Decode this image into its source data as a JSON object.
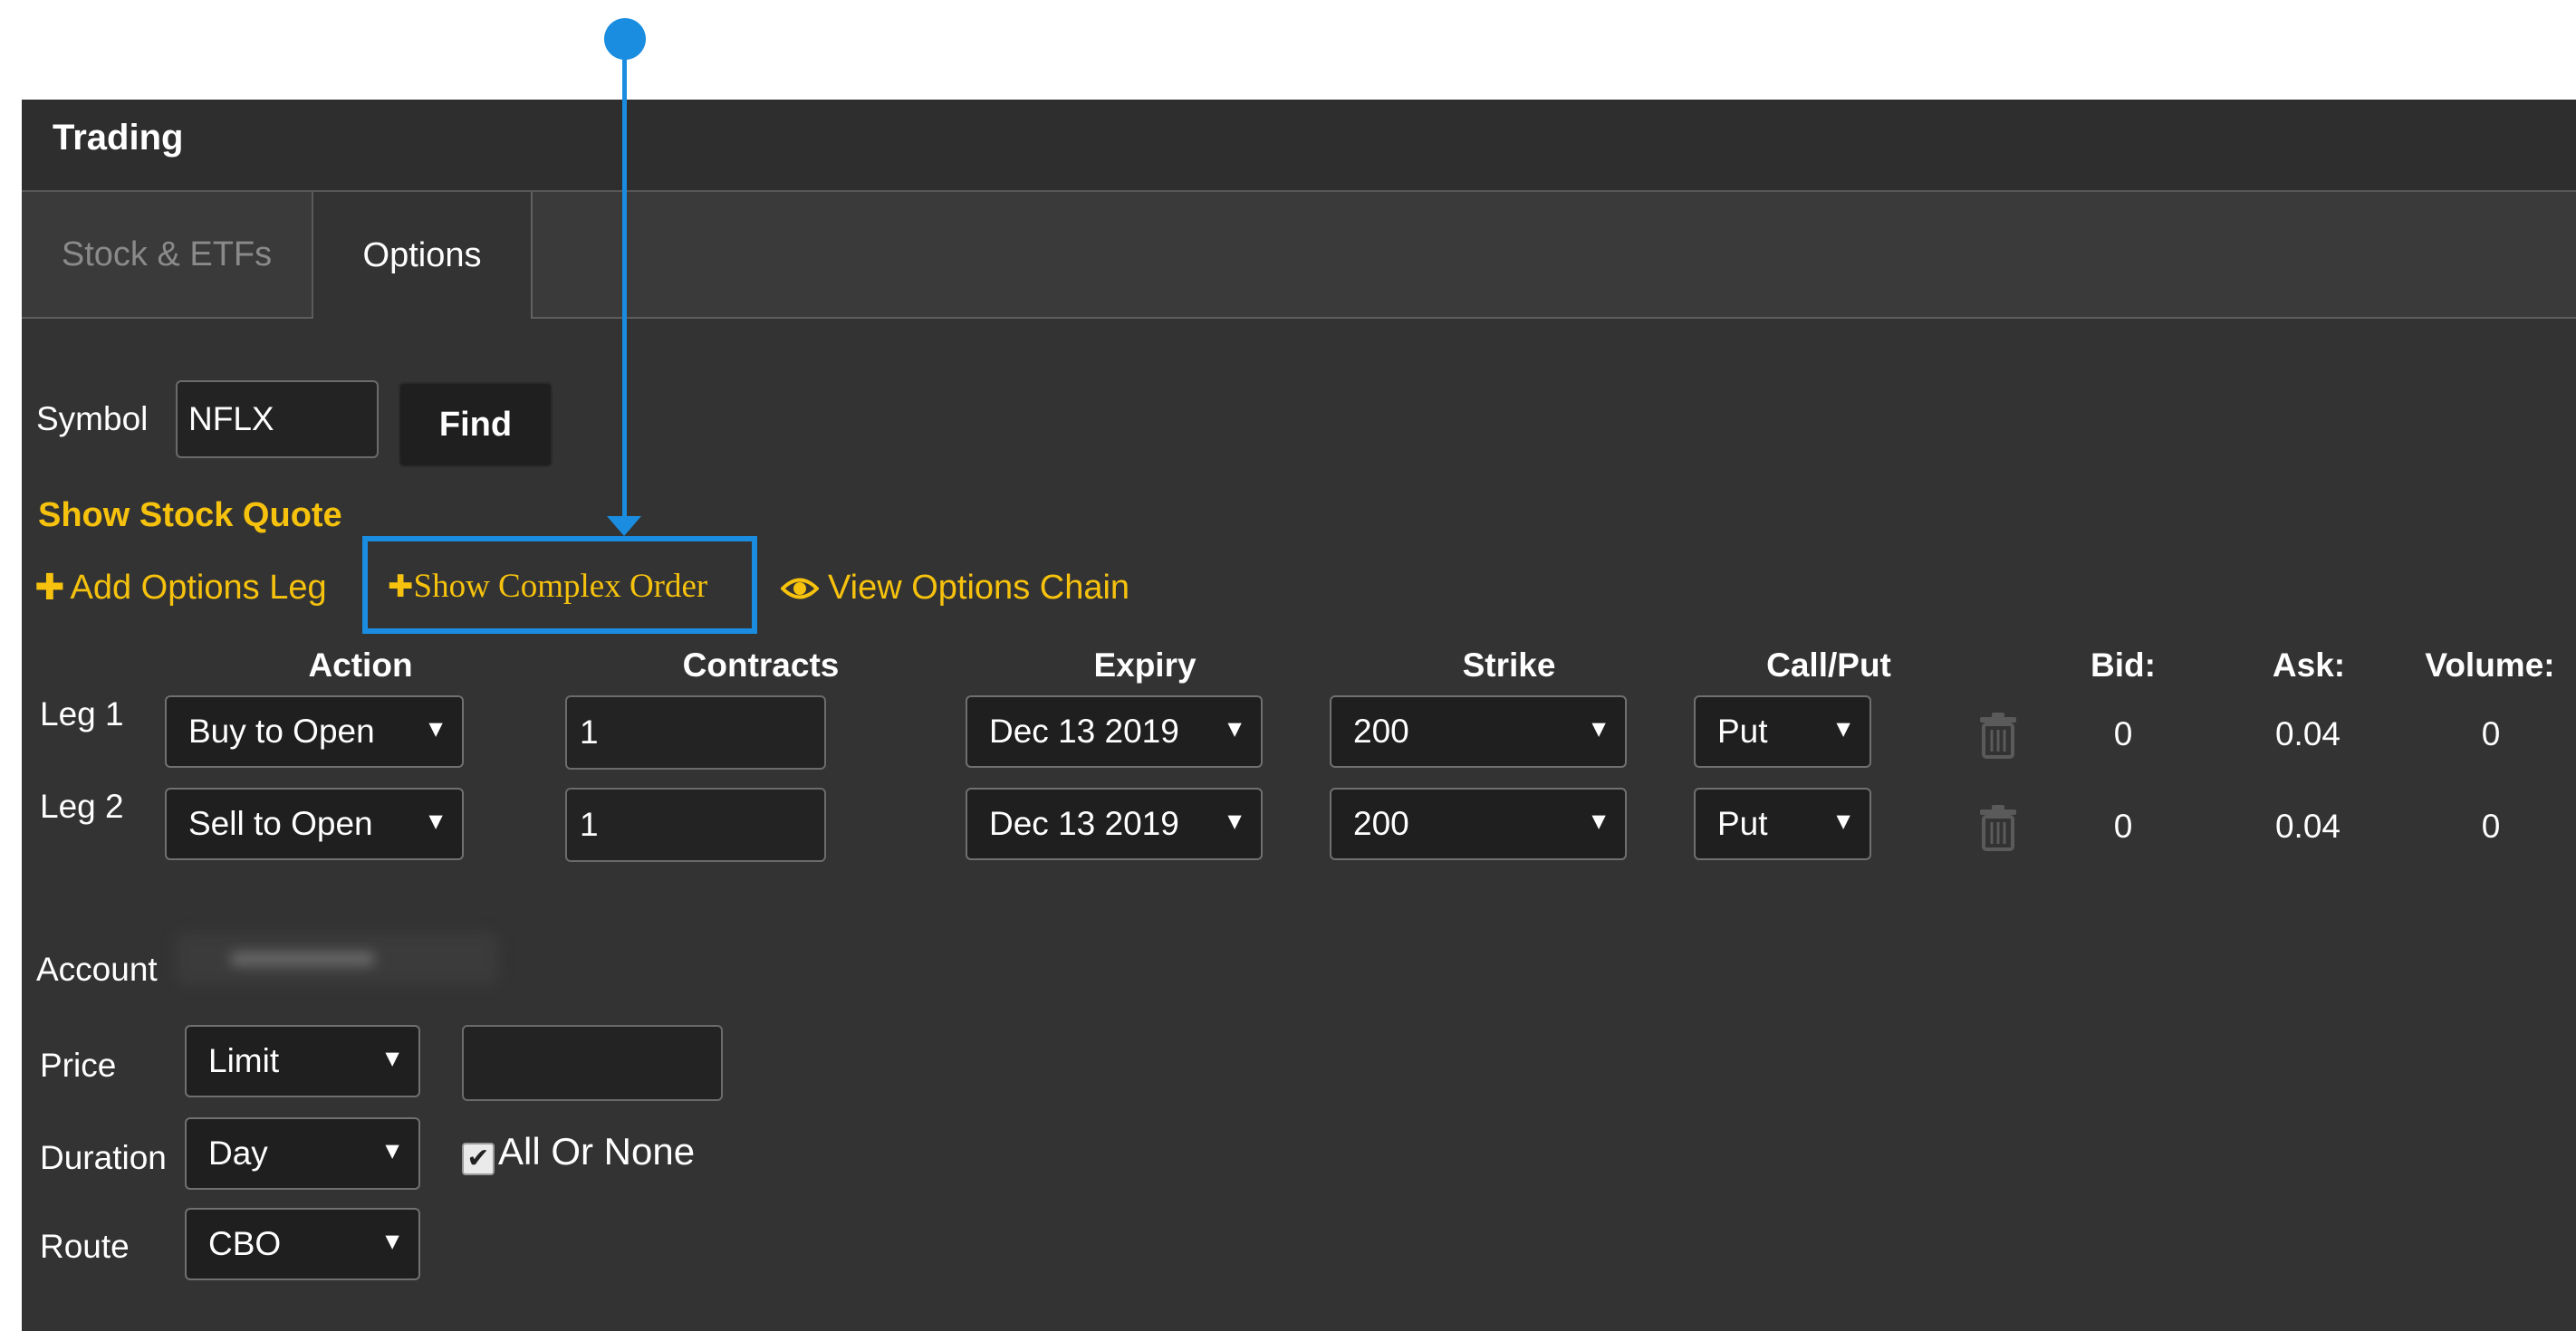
{
  "window": {
    "title": "Trading"
  },
  "tabs": [
    {
      "label": "Stock & ETFs",
      "active": false
    },
    {
      "label": "Options",
      "active": true
    }
  ],
  "symbol": {
    "label": "Symbol",
    "value": "NFLX",
    "find_label": "Find"
  },
  "links": {
    "show_stock_quote": "Show Stock Quote",
    "add_options_leg": "Add Options Leg",
    "show_complex_order": "Show Complex Order",
    "view_options_chain": "View Options Chain"
  },
  "legs_table": {
    "headers": {
      "action": "Action",
      "contracts": "Contracts",
      "expiry": "Expiry",
      "strike": "Strike",
      "callput": "Call/Put",
      "bid": "Bid:",
      "ask": "Ask:",
      "volume": "Volume:"
    },
    "rows": [
      {
        "label": "Leg 1",
        "action": "Buy to Open",
        "contracts": "1",
        "expiry": "Dec 13 2019",
        "strike": "200",
        "callput": "Put",
        "bid": "0",
        "ask": "0.04",
        "volume": "0"
      },
      {
        "label": "Leg 2",
        "action": "Sell to Open",
        "contracts": "1",
        "expiry": "Dec 13 2019",
        "strike": "200",
        "callput": "Put",
        "bid": "0",
        "ask": "0.04",
        "volume": "0"
      }
    ]
  },
  "account": {
    "label": "Account"
  },
  "price": {
    "label": "Price",
    "type": "Limit",
    "value": ""
  },
  "duration": {
    "label": "Duration",
    "value": "Day"
  },
  "all_or_none": {
    "label": "All Or None",
    "checked": true
  },
  "route": {
    "label": "Route",
    "value": "CBO"
  },
  "icons": {
    "dropdown": "dropdown-arrow-icon",
    "plus": "plus-icon",
    "eye": "eye-icon",
    "trash": "trash-icon",
    "check": "checkmark-icon"
  },
  "colors": {
    "panel_bg": "#333333",
    "link": "#f6c20d",
    "highlight": "#1a8de0"
  }
}
